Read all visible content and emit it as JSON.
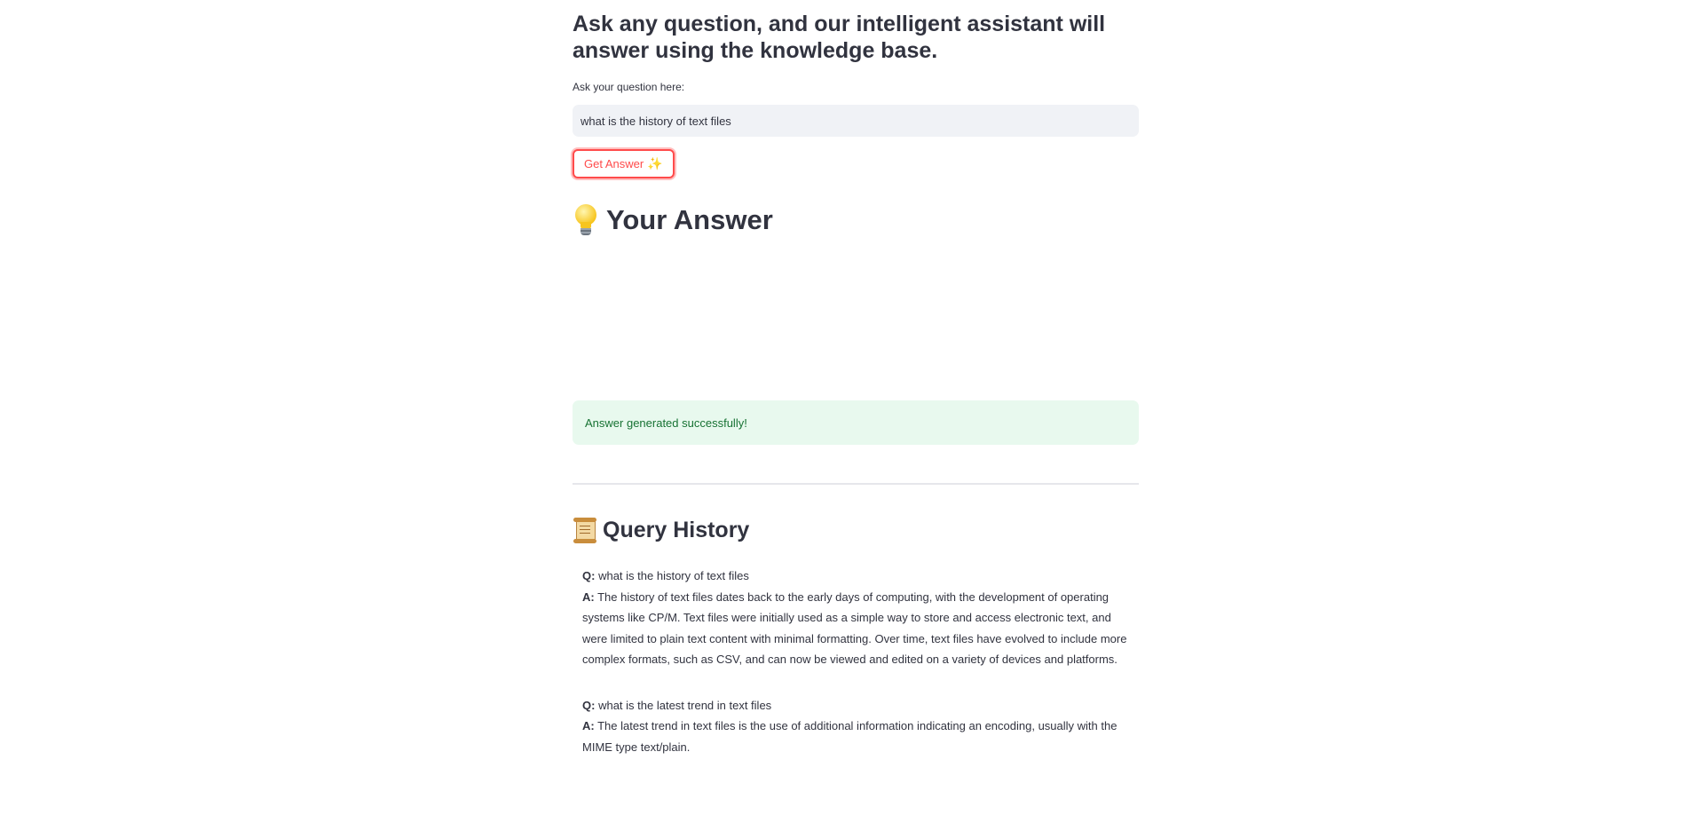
{
  "header": {
    "subtitle": "Ask any question, and our intelligent assistant will answer using the knowledge base."
  },
  "question_input": {
    "label": "Ask your question here:",
    "value": "what is the history of text files"
  },
  "get_answer_button": {
    "label": "Get Answer",
    "icon": "sparkles-icon"
  },
  "answer_section": {
    "icon": "light-bulb-icon",
    "title": "Your Answer"
  },
  "status": {
    "message": "Answer generated successfully!",
    "color": "#177233",
    "background": "#e8f9ee"
  },
  "history": {
    "icon": "scroll-icon",
    "title": "Query History",
    "q_prefix": "Q:",
    "a_prefix": "A:",
    "items": [
      {
        "question": "what is the history of text files",
        "answer": "The history of text files dates back to the early days of computing, with the development of operating systems like CP/M. Text files were initially used as a simple way to store and access electronic text, and were limited to plain text content with minimal formatting. Over time, text files have evolved to include more complex formats, such as CSV, and can now be viewed and edited on a variety of devices and platforms."
      },
      {
        "question": "what is the latest trend in text files",
        "answer": "The latest trend in text files is the use of additional information indicating an encoding, usually with the MIME type text/plain."
      }
    ]
  },
  "colors": {
    "accent": "#ff4b4b",
    "text": "#31333f",
    "input_bg": "#f0f2f6"
  }
}
